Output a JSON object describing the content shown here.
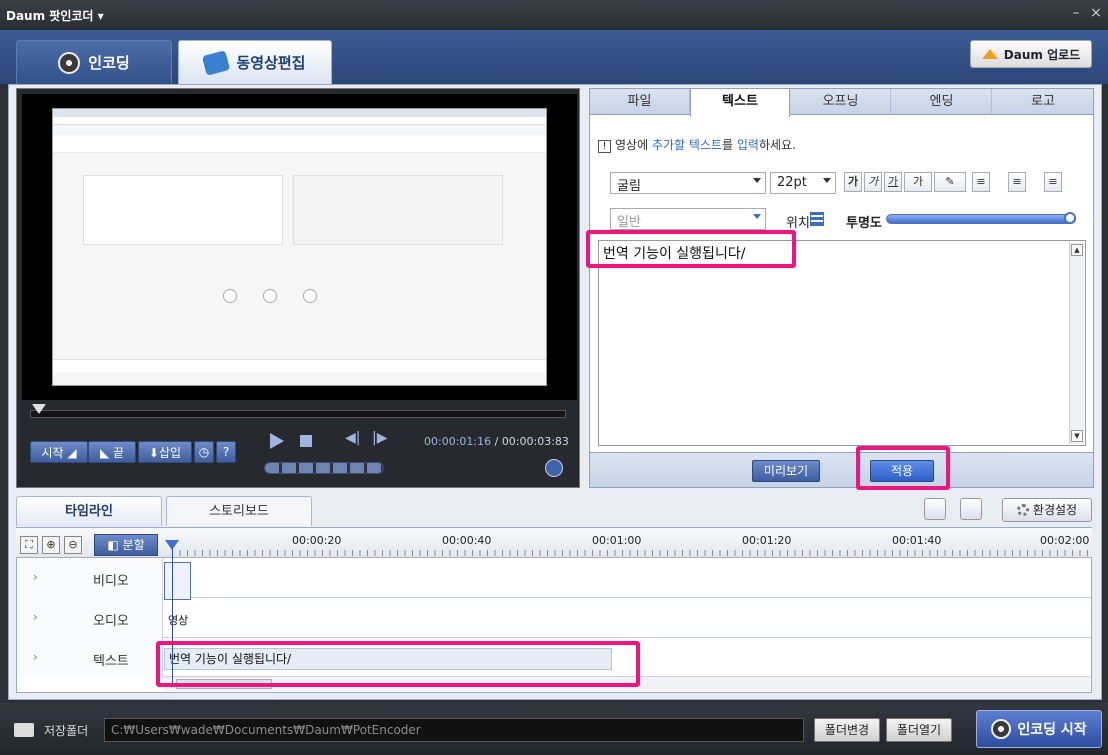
{
  "window": {
    "title": "Daum 팟인코더 ▾",
    "minimize": "–",
    "close": "×"
  },
  "main_tabs": [
    {
      "label": "인코딩"
    },
    {
      "label": "동영상편집"
    }
  ],
  "upload_button": "Daum 업로드",
  "player": {
    "current_time": "00:00:01:16",
    "separator": " / ",
    "total_time": "00:00:03:83",
    "buttons": {
      "start": "시작 ◢",
      "end": "◣ 끝",
      "insert": "⬇삽입",
      "clock": "◷",
      "help": "?"
    }
  },
  "text_panel": {
    "tabs": [
      "파일",
      "텍스트",
      "오프닝",
      "엔딩",
      "로고"
    ],
    "active_tab": 1,
    "hint_prefix": "영상에 ",
    "hint_highlight1": "추가할 텍스트",
    "hint_mid": "를 ",
    "hint_highlight2": "입력",
    "hint_suffix": "하세요.",
    "font": "굴림",
    "size": "22pt",
    "format_buttons": [
      "가",
      "가",
      "가",
      "가"
    ],
    "style": "일반",
    "position_label": "위치",
    "opacity_label": "투명도",
    "opacity": 1.0,
    "text": "번역 기능이 실행됩니다/",
    "preview_button": "미리보기",
    "apply_button": "적용"
  },
  "timeline": {
    "tabs": [
      "타임라인",
      "스토리보드"
    ],
    "settings_button": "환경설정",
    "split_button": "분할",
    "ruler": [
      "00:00:20",
      "00:00:40",
      "00:01:00",
      "00:01:20",
      "00:01:40",
      "00:02:00"
    ],
    "tracks": [
      "비디오",
      "오디오",
      "텍스트"
    ],
    "audio_clip": "영상",
    "text_clip": "번역 기능이 실행됩니다/"
  },
  "bottom": {
    "folder_label": "저장폴더",
    "path": "C:₩Users₩wade₩Documents₩Daum₩PotEncoder",
    "change_folder": "폴더변경",
    "open_folder": "폴더열기",
    "encode_start": "인코딩 시작"
  },
  "colors": {
    "highlight": "#f0147e",
    "accent": "#3e5e9e"
  }
}
